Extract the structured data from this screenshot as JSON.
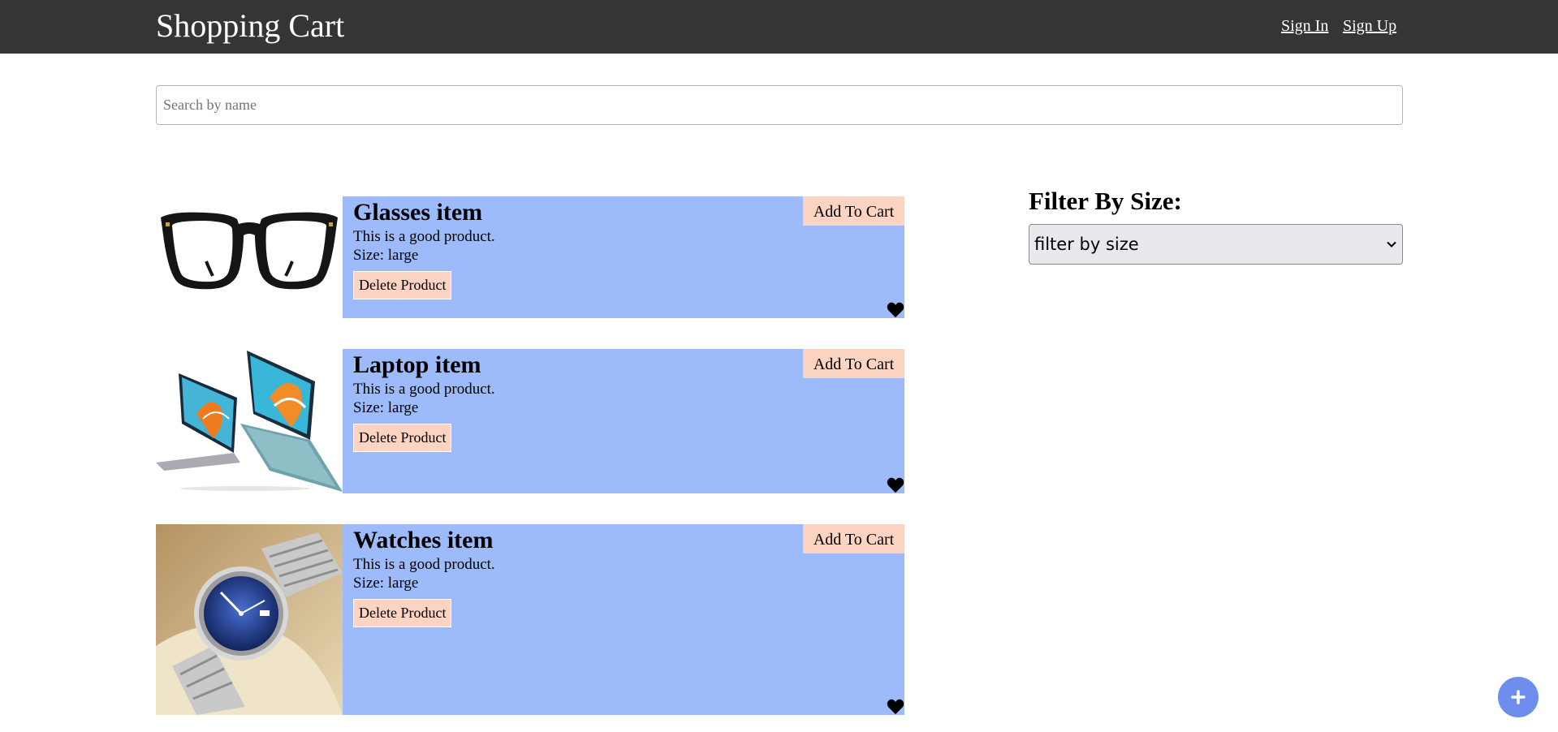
{
  "header": {
    "title": "Shopping Cart",
    "sign_in": "Sign In",
    "sign_up": "Sign Up"
  },
  "search": {
    "placeholder": "Search by name",
    "value": ""
  },
  "products": [
    {
      "name": "Glasses item",
      "description": "This is a good product.",
      "size": "Size: large",
      "add_label": "Add To Cart",
      "delete_label": "Delete Product",
      "image": "glasses"
    },
    {
      "name": "Laptop item",
      "description": "This is a good product.",
      "size": "Size: large",
      "add_label": "Add To Cart",
      "delete_label": "Delete Product",
      "image": "laptop"
    },
    {
      "name": "Watches item",
      "description": "This is a good product.",
      "size": "Size: large",
      "add_label": "Add To Cart",
      "delete_label": "Delete Product",
      "image": "watch"
    }
  ],
  "filter": {
    "title": "Filter By Size:",
    "selected": "filter by size"
  },
  "icons": {
    "favorite": "heart-icon",
    "add_fab": "plus-icon",
    "select": "chevron-down-icon"
  },
  "colors": {
    "header_bg": "#353535",
    "card_bg": "#9dbbfb",
    "button_bg": "#fdd3c2",
    "fab_bg": "#6e8eee"
  }
}
